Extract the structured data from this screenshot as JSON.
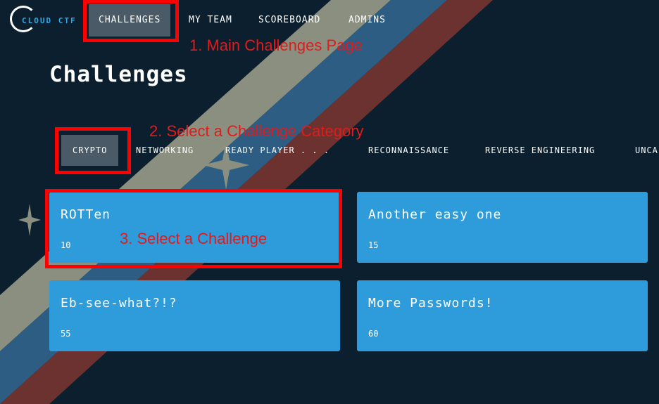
{
  "logo": {
    "text": "CLOUD CTF",
    "icon": "cloud-ctf-logo"
  },
  "nav": {
    "items": [
      {
        "label": "CHALLENGES",
        "active": true
      },
      {
        "label": "MY TEAM",
        "active": false
      },
      {
        "label": "SCOREBOARD",
        "active": false
      },
      {
        "label": "ADMINS",
        "active": false
      }
    ]
  },
  "page": {
    "title": "Challenges"
  },
  "categories": [
    {
      "label": "CRYPTO",
      "active": true
    },
    {
      "label": "NETWORKING",
      "active": false
    },
    {
      "label": "READY PLAYER . . .",
      "active": false
    },
    {
      "label": "RECONNAISSANCE",
      "active": false
    },
    {
      "label": "REVERSE ENGINEERING",
      "active": false
    },
    {
      "label": "UNCA",
      "active": false
    }
  ],
  "challenges": [
    {
      "name": "ROTTen",
      "points": "10"
    },
    {
      "name": "Another easy one",
      "points": "15"
    },
    {
      "name": "Eb-see-what?!?",
      "points": "55"
    },
    {
      "name": "More Passwords!",
      "points": "60"
    }
  ],
  "annotations": {
    "step1": "1. Main Challenges Page",
    "step2": "2. Select a Challenge Category",
    "step3": "3. Select a Challenge"
  },
  "colors": {
    "background": "#0b1f2e",
    "card": "#2e9bdb",
    "active_tab": "#4a5a66",
    "highlight": "#ff0000",
    "annotation_text": "#e31a1a",
    "stripe_gray": "#8a8f80",
    "stripe_blue": "#2d5d82",
    "stripe_red": "#6b3230"
  }
}
